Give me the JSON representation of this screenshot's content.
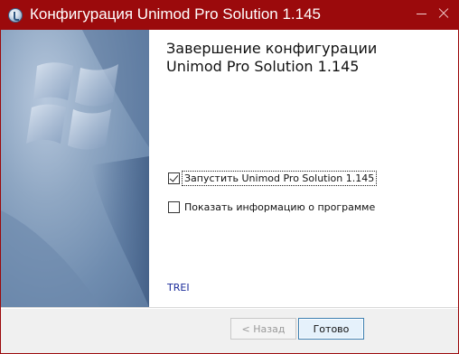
{
  "window": {
    "title": "Конфигурация Unimod Pro Solution 1.145",
    "frame_color": "#9b0a0c",
    "controls": {
      "minimize": "minimize-icon",
      "close": "close-icon"
    }
  },
  "main": {
    "heading_line1": "Завершение конфигурации",
    "heading_line2": "Unimod Pro Solution 1.145",
    "options": [
      {
        "label": "Запустить Unimod Pro Solution 1.145",
        "checked": true
      },
      {
        "label": "Показать информацию о программе",
        "checked": false
      }
    ],
    "brand": "TREI"
  },
  "footer": {
    "back_label": "< Назад",
    "back_enabled": false,
    "finish_label": "Готово"
  }
}
